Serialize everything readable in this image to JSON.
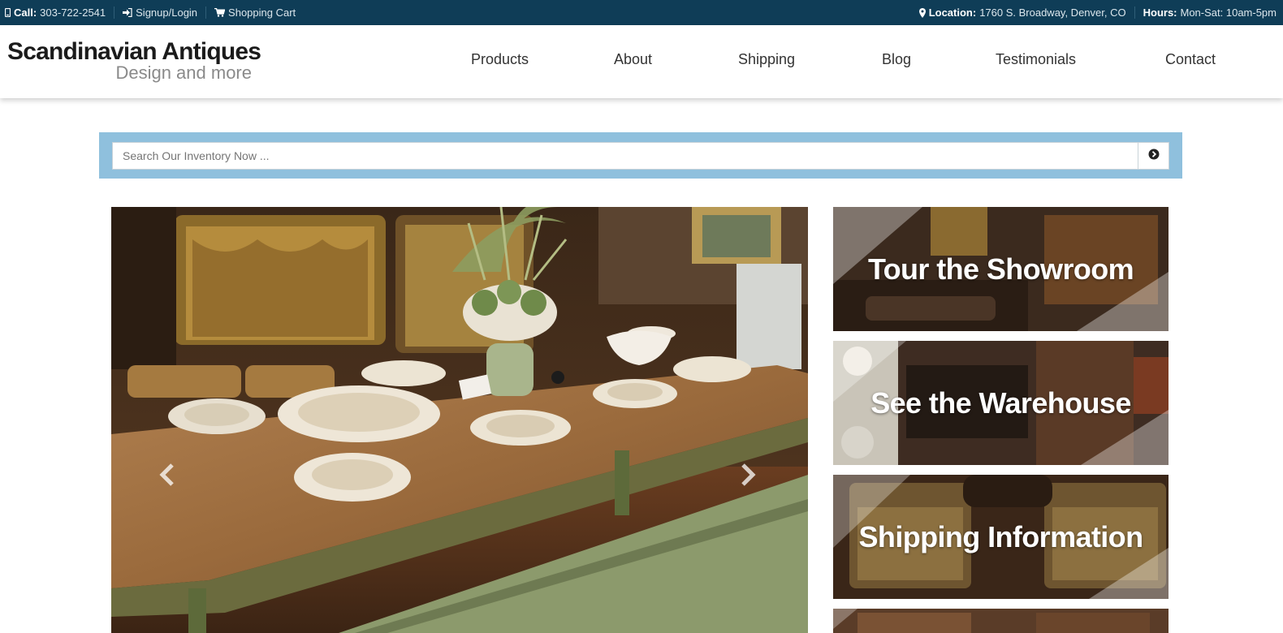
{
  "topbar": {
    "call_label": "Call:",
    "phone": "303-722-2541",
    "signup": "Signup/Login",
    "cart": "Shopping Cart",
    "location_label": "Location:",
    "location": "1760 S. Broadway, Denver, CO",
    "hours_label": "Hours:",
    "hours": "Mon-Sat: 10am-5pm",
    "icons": [
      "mobile-phone-icon",
      "sign-in-icon",
      "shopping-cart-icon",
      "map-marker-icon"
    ]
  },
  "logo": {
    "line1": "Scandinavian Antiques",
    "line2": "Design and more"
  },
  "nav": [
    "Products",
    "About",
    "Shipping",
    "Blog",
    "Testimonials",
    "Contact"
  ],
  "search": {
    "placeholder": "Search Our Inventory Now ...",
    "button_icon": "chevron-circle-right-icon"
  },
  "carousel": {
    "prev_icon": "chevron-left-icon",
    "next_icon": "chevron-right-icon"
  },
  "tiles": [
    {
      "label": "Tour the Showroom"
    },
    {
      "label": "See the Warehouse"
    },
    {
      "label": "Shipping Information"
    },
    {
      "label": ""
    }
  ],
  "colors": {
    "topbar_bg": "#0f3d57",
    "search_band": "#8fc0dd",
    "text_dark": "#333333"
  }
}
